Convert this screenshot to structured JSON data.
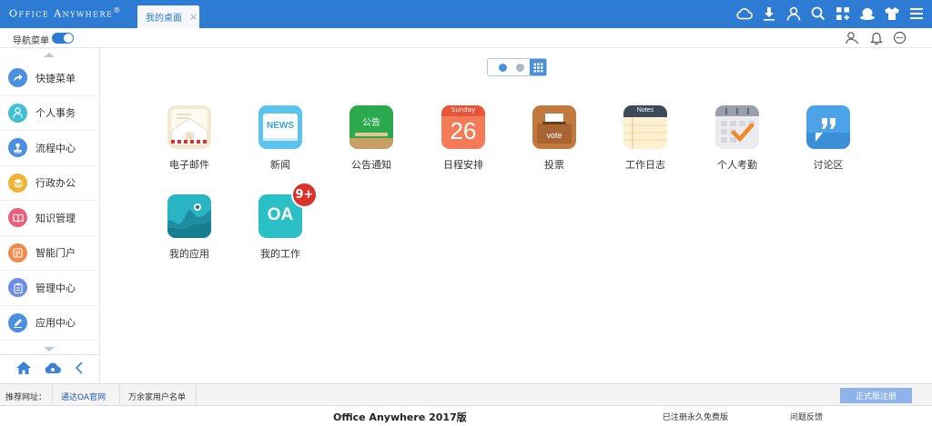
{
  "header": {
    "brand": "Office Anywhere",
    "brand_mark": "®",
    "tab_label": "我的桌面",
    "tab_close": "×",
    "icons": [
      "cloud-icon",
      "download-icon",
      "user-icon",
      "search-icon",
      "grid-add-icon",
      "hat-icon",
      "shirt-icon",
      "menu-icon"
    ]
  },
  "subbar": {
    "nav_label": "导航菜单",
    "nav_toggle_on": true,
    "icons": [
      "users-search-icon",
      "bell-icon",
      "chat-icon"
    ]
  },
  "sidebar": {
    "items": [
      {
        "label": "快捷菜单",
        "icon": "share-arrow-icon",
        "color": "#4a8fe0"
      },
      {
        "label": "个人事务",
        "icon": "person-icon",
        "color": "#3fbfd3"
      },
      {
        "label": "流程中心",
        "icon": "stamp-icon",
        "color": "#4a8fe0"
      },
      {
        "label": "行政办公",
        "icon": "layers-icon",
        "color": "#f2b233"
      },
      {
        "label": "知识管理",
        "icon": "book-icon",
        "color": "#e8607a"
      },
      {
        "label": "智能门户",
        "icon": "portal-icon",
        "color": "#f08a4b"
      },
      {
        "label": "管理中心",
        "icon": "clipboard-icon",
        "color": "#6e8de8"
      },
      {
        "label": "应用中心",
        "icon": "pencil-icon",
        "color": "#4a8fe0"
      }
    ],
    "footer_icons": [
      "home-icon",
      "cloud-settings-icon",
      "collapse-left-icon"
    ]
  },
  "main": {
    "pager": {
      "pages": 2,
      "current": 1
    },
    "apps": [
      {
        "label": "电子邮件",
        "icon": "mail-icon"
      },
      {
        "label": "新闻",
        "icon": "news-icon",
        "text": "NEWS"
      },
      {
        "label": "公告通知",
        "icon": "notice-board-icon",
        "text": "公告"
      },
      {
        "label": "日程安排",
        "icon": "calendar-icon",
        "text": "Sunday",
        "number": "26"
      },
      {
        "label": "投票",
        "icon": "vote-box-icon",
        "text": "vote"
      },
      {
        "label": "工作日志",
        "icon": "notes-icon",
        "text": "Notes"
      },
      {
        "label": "个人考勤",
        "icon": "attendance-calendar-icon"
      },
      {
        "label": "讨论区",
        "icon": "discussion-quote-icon"
      },
      {
        "label": "我的应用",
        "icon": "my-apps-icon"
      },
      {
        "label": "我的工作",
        "icon": "oa-icon",
        "text": "OA",
        "badge": "9+"
      }
    ]
  },
  "bottombar": {
    "rec_label": "推荐网址：",
    "links": [
      "通达OA官网",
      "万余家用户名单"
    ],
    "register_button": "正式版注册"
  },
  "footer": {
    "title": "Office Anywhere 2017版",
    "registered": "已注册永久免费版",
    "feedback": "问题反馈"
  }
}
